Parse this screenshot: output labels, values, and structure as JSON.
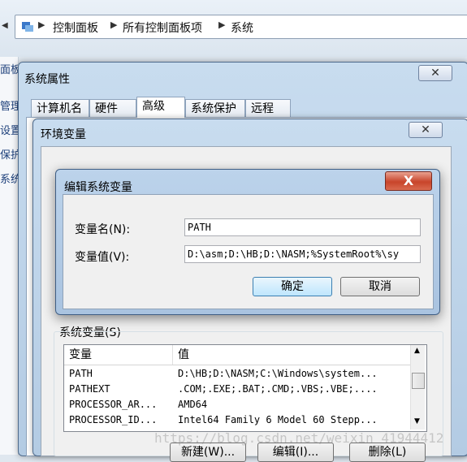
{
  "breadcrumb": [
    "控制面板",
    "所有控制面板项",
    "系统"
  ],
  "left_pane": [
    "面板",
    "管理",
    "设置",
    "保护",
    "系统"
  ],
  "system_props": {
    "title": "系统属性",
    "tabs": [
      "计算机名",
      "硬件",
      "高级",
      "系统保护",
      "远程"
    ],
    "active_tab": "高级"
  },
  "env_vars": {
    "title": "环境变量",
    "system_vars_label": "系统变量(S)",
    "columns": [
      "变量",
      "值"
    ],
    "rows": [
      {
        "name": "PATH",
        "value": "D:\\HB;D:\\NASM;C:\\Windows\\system..."
      },
      {
        "name": "PATHEXT",
        "value": ".COM;.EXE;.BAT;.CMD;.VBS;.VBE;...."
      },
      {
        "name": "PROCESSOR_AR...",
        "value": "AMD64"
      },
      {
        "name": "PROCESSOR_ID...",
        "value": "Intel64 Family 6 Model 60 Stepp..."
      }
    ],
    "bottom_buttons": [
      "新建(W)...",
      "编辑(I)...",
      "删除(L)"
    ]
  },
  "edit_dialog": {
    "title": "编辑系统变量",
    "name_label": "变量名(N):",
    "value_label": "变量值(V):",
    "name_value": "PATH",
    "value_value": "D:\\asm;D:\\HB;D:\\NASM;%SystemRoot%\\sy",
    "ok": "确定",
    "cancel": "取消",
    "close": "X"
  },
  "watermark": "https://blog.csdn.net/weixin_41944412"
}
